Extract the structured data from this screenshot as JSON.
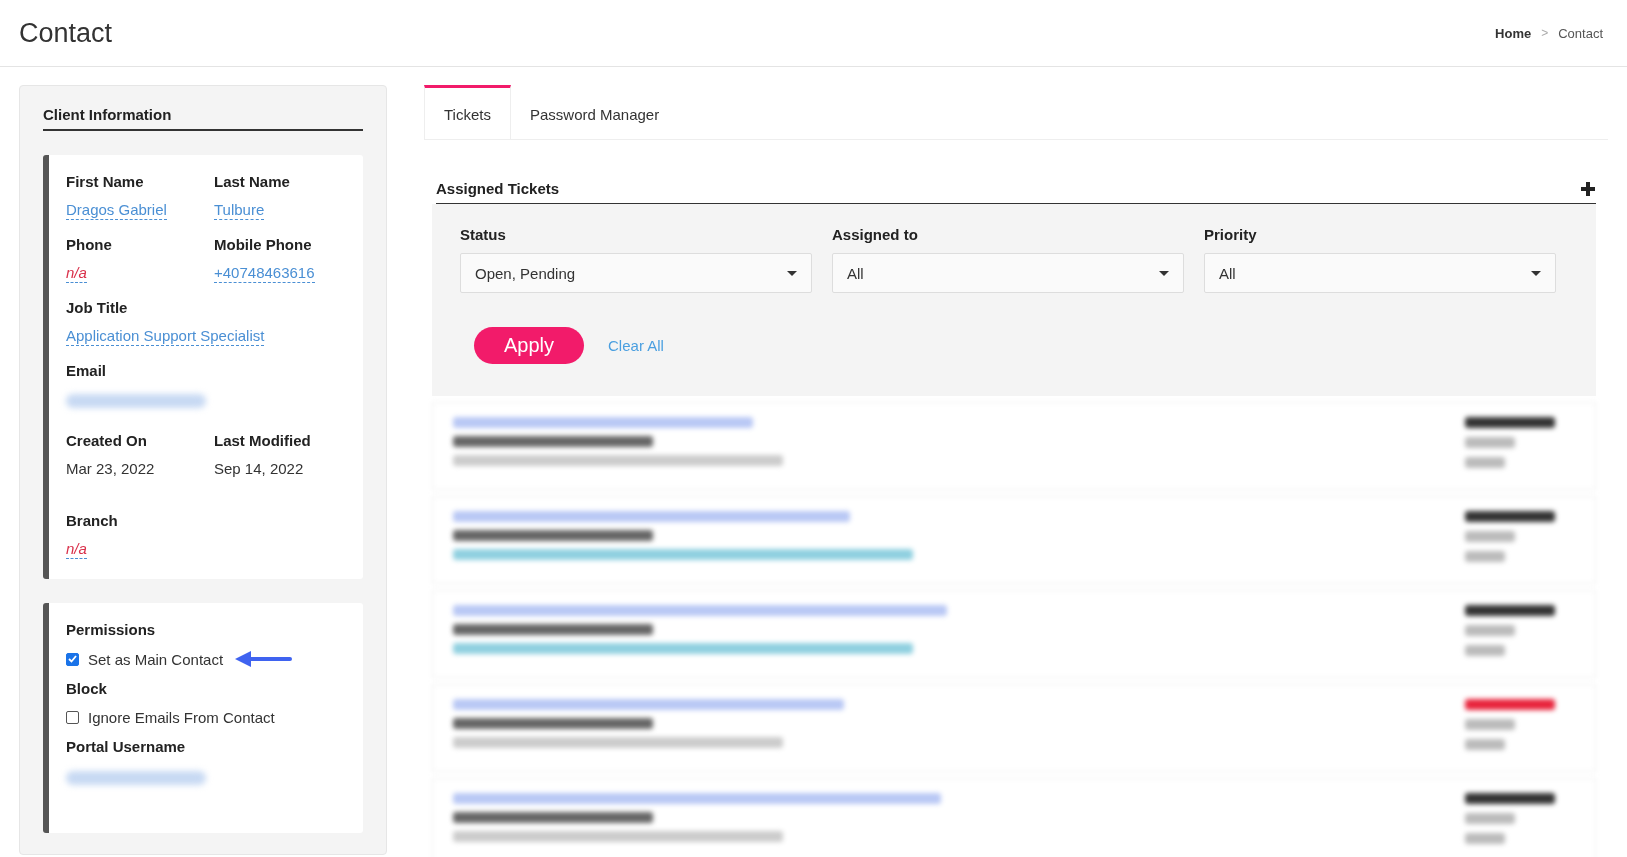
{
  "header": {
    "title": "Contact",
    "breadcrumb": [
      {
        "label": "Home",
        "current": false
      },
      {
        "label": "Contact",
        "current": true
      }
    ],
    "separator": ">"
  },
  "client_information": {
    "title": "Client Information",
    "fields": [
      {
        "label": "First Name",
        "value": "Dragos Gabriel",
        "kind": "link",
        "half": true
      },
      {
        "label": "Last Name",
        "value": "Tulbure",
        "kind": "link",
        "half": true
      },
      {
        "label": "Phone",
        "value": "n/a",
        "kind": "empty",
        "half": true
      },
      {
        "label": "Mobile Phone",
        "value": "+40748463616",
        "kind": "link",
        "half": true
      },
      {
        "label": "Job Title",
        "value": "Application Support Specialist",
        "kind": "link",
        "half": false
      },
      {
        "label": "Email",
        "kind": "blurred",
        "half": false
      },
      {
        "label": "Created On",
        "value": "Mar 23, 2022",
        "kind": "plain",
        "half": true
      },
      {
        "label": "Last Modified",
        "value": "Sep 14, 2022",
        "kind": "plain",
        "half": true
      },
      {
        "label": "Branch",
        "value": "n/a",
        "kind": "empty",
        "half": false
      }
    ]
  },
  "permissions": [
    {
      "kind": "heading",
      "label": "Permissions"
    },
    {
      "kind": "checkbox",
      "label": "Set as Main Contact",
      "checked": true,
      "annotated": true
    },
    {
      "kind": "heading",
      "label": "Block"
    },
    {
      "kind": "checkbox",
      "label": "Ignore Emails From Contact",
      "checked": false,
      "annotated": false
    },
    {
      "kind": "heading",
      "label": "Portal Username"
    },
    {
      "kind": "blurred"
    }
  ],
  "tabs": [
    {
      "label": "Tickets",
      "selected": true
    },
    {
      "label": "Password Manager",
      "selected": false
    }
  ],
  "assigned_tickets": {
    "title": "Assigned Tickets",
    "filters": [
      {
        "label": "Status",
        "value": "Open, Pending"
      },
      {
        "label": "Assigned to",
        "value": "All"
      },
      {
        "label": "Priority",
        "value": "All"
      }
    ],
    "apply": "Apply",
    "clear": "Clear All",
    "rows": [
      {
        "tagged": false,
        "color": "#333333"
      },
      {
        "tagged": true,
        "color": "#333333"
      },
      {
        "tagged": true,
        "color": "#333333"
      },
      {
        "tagged": false,
        "color": "#e8243c"
      },
      {
        "tagged": false,
        "color": "#333333"
      }
    ]
  }
}
